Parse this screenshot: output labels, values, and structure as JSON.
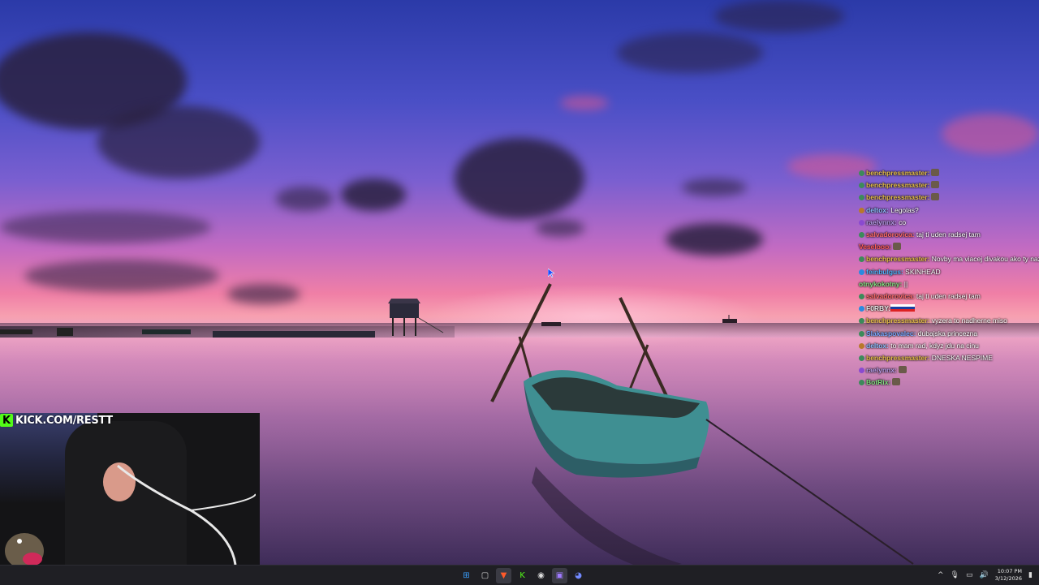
{
  "stream_overlay": {
    "channel_label": "KICK.COM/RESTT",
    "kick_logo": "K"
  },
  "chat": {
    "messages": [
      {
        "user": "benchpressmaster",
        "text": "",
        "badge": "#3c8a5a",
        "color": "#e8c04a",
        "emote": true
      },
      {
        "user": "benchpressmaster",
        "text": "",
        "badge": "#3c8a5a",
        "color": "#e8c04a",
        "emote": true
      },
      {
        "user": "benchpressmaster",
        "text": "",
        "badge": "#3c8a5a",
        "color": "#e8c04a",
        "emote": true
      },
      {
        "user": "deltox",
        "text": "Legolas?",
        "badge": "#b8782a",
        "color": "#8fc0ff"
      },
      {
        "user": "raelynnx",
        "text": "co",
        "badge": "#8a4ad0",
        "color": "#b59be6"
      },
      {
        "user": "salvadorovica",
        "text": "taj ti uden radsej tam",
        "badge": "#3c8a5a",
        "color": "#ff6a6a"
      },
      {
        "user": "Veselooo",
        "text": "",
        "badge": "",
        "color": "#ff5a5a",
        "emote": true
      },
      {
        "user": "benchpressmaster",
        "text": "Novby ma viacej divakou ako ty nazor?",
        "badge": "#3c8a5a",
        "color": "#e8c04a"
      },
      {
        "user": "feinbulgus",
        "text": "SKINHEAD",
        "badge": "#2a8ae0",
        "color": "#4fb6ff"
      },
      {
        "user": "otnykokotny",
        "text": "||",
        "badge": "",
        "color": "#7fe07f"
      },
      {
        "user": "salvadorovica",
        "text": "taj ti uden radsej tam",
        "badge": "#3c8a5a",
        "color": "#ff6a6a"
      },
      {
        "user": "F0RBY",
        "text": "",
        "badge": "#2a8ae0",
        "color": "#e8e8e8",
        "flag": true
      },
      {
        "user": "benchpressmaster",
        "text": "vyzera to nadherne miso",
        "badge": "#3c8a5a",
        "color": "#e8c04a"
      },
      {
        "user": "Slakaspovalec",
        "text": "dubajska princezna",
        "badge": "#3c8a5a",
        "color": "#7aa8ff"
      },
      {
        "user": "deltox",
        "text": "to mam rad, kdyz jdu na cinu",
        "badge": "#b8782a",
        "color": "#8fc0ff"
      },
      {
        "user": "benchpressmaster",
        "text": "DNESKA NESPIME",
        "badge": "#3c8a5a",
        "color": "#e8c04a"
      },
      {
        "user": "raelynnx",
        "text": "",
        "badge": "#8a4ad0",
        "color": "#b59be6",
        "emote": true
      },
      {
        "user": "BotRix",
        "text": "",
        "badge": "#3c8a5a",
        "color": "#7fe07f",
        "emote": true
      }
    ]
  },
  "taskbar": {
    "apps": [
      {
        "name": "start",
        "glyph": "⊞",
        "color": "#3aa0ff"
      },
      {
        "name": "task-view",
        "glyph": "▢",
        "color": "#cfcfcf"
      },
      {
        "name": "brave",
        "glyph": "▼",
        "color": "#ff5a2a"
      },
      {
        "name": "kick",
        "glyph": "K",
        "color": "#53fc18"
      },
      {
        "name": "obs",
        "glyph": "◉",
        "color": "#dddddd"
      },
      {
        "name": "app-purple",
        "glyph": "▣",
        "color": "#a07aff"
      },
      {
        "name": "discord",
        "glyph": "◕",
        "color": "#7289ff"
      }
    ],
    "tray": {
      "chevron": "^",
      "mic": "🎙",
      "network": "▭",
      "volume": "🔊",
      "time": "10:07 PM",
      "date": "3/12/2026",
      "notification": "▮"
    }
  }
}
